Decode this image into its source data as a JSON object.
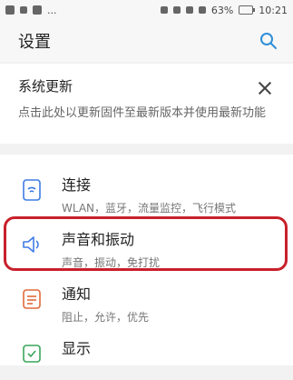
{
  "status_bar": {
    "battery": "63%",
    "time": "10:21"
  },
  "header": {
    "title": "设置",
    "search_icon": "search-icon"
  },
  "update_card": {
    "title": "系统更新",
    "description": "点击此处以更新固件至最新版本并使用最新功能",
    "close_icon": "close-icon"
  },
  "items": [
    {
      "title": "连接",
      "subtitle": "WLAN，蓝牙，流量监控，飞行模式",
      "icon": "connection-icon",
      "icon_color": "#3e7be6"
    },
    {
      "title": "声音和振动",
      "subtitle": "声音，振动，免打扰",
      "icon": "speaker-icon",
      "icon_color": "#3e7be6"
    },
    {
      "title": "通知",
      "subtitle": "阻止，允许，优先",
      "icon": "notification-icon",
      "icon_color": "#e06a3a"
    },
    {
      "title": "显示",
      "subtitle": "",
      "icon": "display-icon",
      "icon_color": "#3aa65a"
    }
  ],
  "highlight_color": "#c8202b"
}
